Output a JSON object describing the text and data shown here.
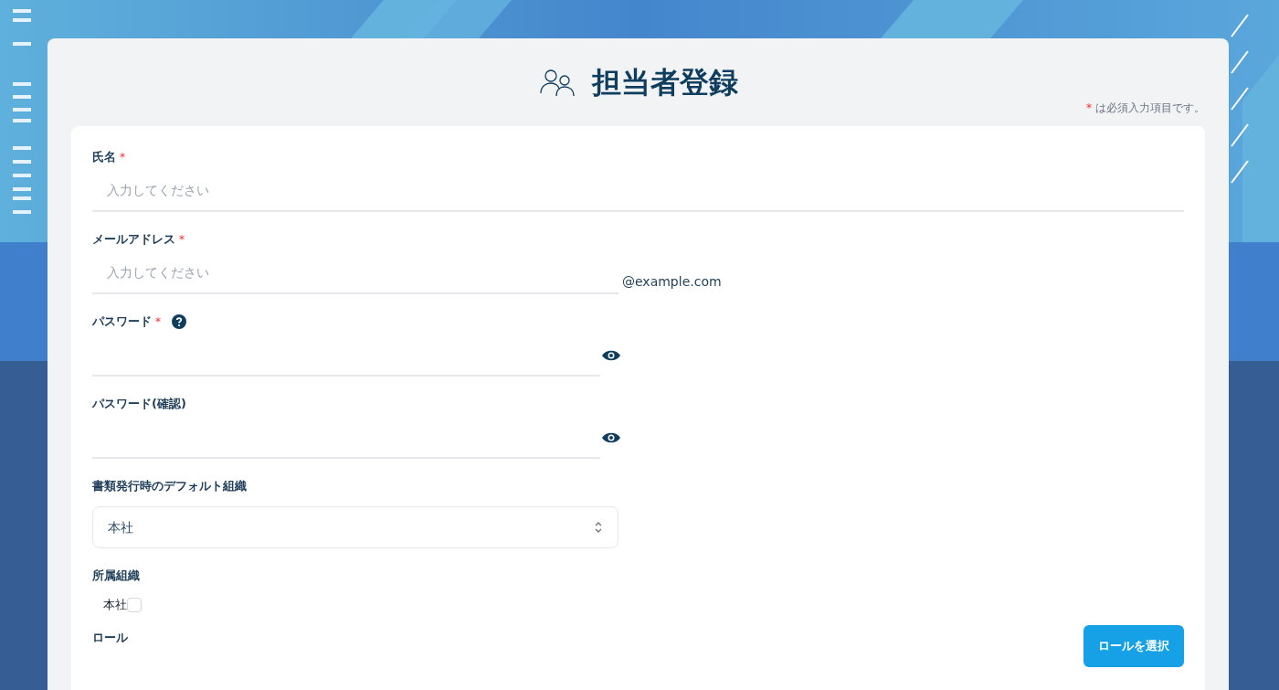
{
  "title": "担当者登録",
  "required_mark": "*",
  "required_note": "は必須入力項目です。",
  "fields": [
    {
      "kind": "text",
      "label": "氏名",
      "required": true,
      "placeholder": "入力してください"
    },
    {
      "kind": "email",
      "label": "メールアドレス",
      "required": true,
      "placeholder": "入力してください",
      "suffix": "@example.com"
    },
    {
      "kind": "password",
      "label": "パスワード",
      "required": true,
      "help": true
    },
    {
      "kind": "password",
      "label": "パスワード(確認)",
      "required": false,
      "help": false
    },
    {
      "kind": "select",
      "label": "書類発行時のデフォルト組織",
      "required": false,
      "value": "本社"
    },
    {
      "kind": "checkboxes",
      "label": "所属組織",
      "required": false,
      "options": [
        {
          "label": "本社",
          "checked": false
        }
      ]
    },
    {
      "kind": "role",
      "label": "ロール",
      "required": false,
      "button": "ロールを選択"
    }
  ]
}
